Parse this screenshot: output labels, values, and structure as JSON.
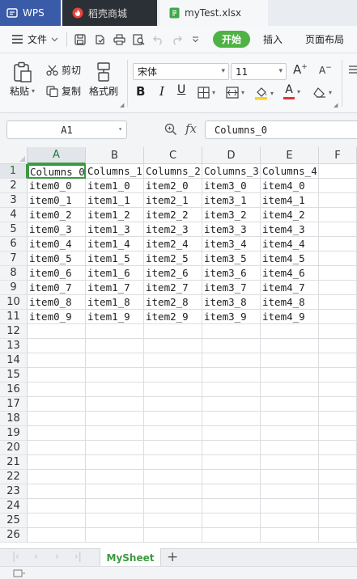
{
  "tabs": {
    "wps": "WPS",
    "store": "稻壳商城",
    "file": "myTest.xlsx"
  },
  "menu": {
    "file": "文件",
    "tabs": [
      "开始",
      "插入",
      "页面布局"
    ]
  },
  "ribbon": {
    "paste": "粘贴",
    "cut": "剪切",
    "copy": "复制",
    "format_painter": "格式刷",
    "font_name": "宋体",
    "font_size": "11"
  },
  "formula_bar": {
    "name_box": "A1",
    "fx": "fx",
    "content": "Columns_0"
  },
  "grid": {
    "columns": [
      "A",
      "B",
      "C",
      "D",
      "E",
      "F"
    ],
    "row_numbers": [
      "1",
      "2",
      "3",
      "4",
      "5",
      "6",
      "7",
      "8",
      "9",
      "10",
      "11",
      "12",
      "13",
      "14",
      "15",
      "16",
      "17",
      "18",
      "19",
      "20",
      "21",
      "22",
      "23",
      "24",
      "25",
      "26"
    ],
    "rows": [
      [
        "Columns_0",
        "Columns_1",
        "Columns_2",
        "Columns_3",
        "Columns_4"
      ],
      [
        "item0_0",
        "item1_0",
        "item2_0",
        "item3_0",
        "item4_0"
      ],
      [
        "item0_1",
        "item1_1",
        "item2_1",
        "item3_1",
        "item4_1"
      ],
      [
        "item0_2",
        "item1_2",
        "item2_2",
        "item3_2",
        "item4_2"
      ],
      [
        "item0_3",
        "item1_3",
        "item2_3",
        "item3_3",
        "item4_3"
      ],
      [
        "item0_4",
        "item1_4",
        "item2_4",
        "item3_4",
        "item4_4"
      ],
      [
        "item0_5",
        "item1_5",
        "item2_5",
        "item3_5",
        "item4_5"
      ],
      [
        "item0_6",
        "item1_6",
        "item2_6",
        "item3_6",
        "item4_6"
      ],
      [
        "item0_7",
        "item1_7",
        "item2_7",
        "item3_7",
        "item4_7"
      ],
      [
        "item0_8",
        "item1_8",
        "item2_8",
        "item3_8",
        "item4_8"
      ],
      [
        "item0_9",
        "item1_9",
        "item2_9",
        "item3_9",
        "item4_9"
      ]
    ],
    "active_cell": "A1"
  },
  "sheets": {
    "active": "MySheet",
    "add": "+"
  },
  "colors": {
    "accent": "#4fb244",
    "wps_tab": "#3a5ba8",
    "store_tab": "#2b2f36",
    "selection": "#3b9b43"
  }
}
